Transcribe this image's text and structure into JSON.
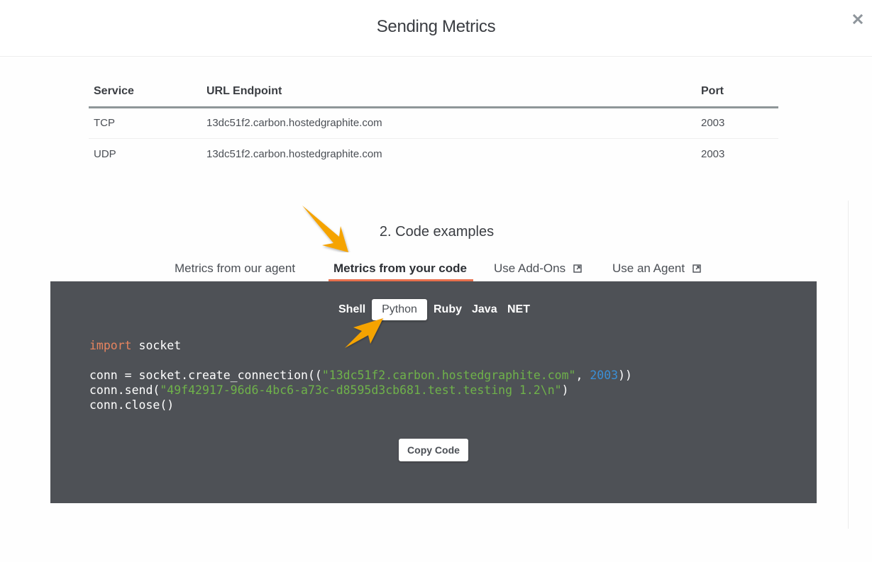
{
  "modal": {
    "title": "Sending Metrics",
    "close_icon": "close-icon"
  },
  "endpoints": {
    "headers": [
      "Service",
      "URL Endpoint",
      "Port"
    ],
    "rows": [
      {
        "service": "TCP",
        "url": "13dc51f2.carbon.hostedgraphite.com",
        "port": "2003"
      },
      {
        "service": "UDP",
        "url": "13dc51f2.carbon.hostedgraphite.com",
        "port": "2003"
      }
    ]
  },
  "code_examples": {
    "title": "2. Code examples",
    "tabs": [
      {
        "label": "Metrics from our agent",
        "active": false,
        "external": false
      },
      {
        "label": "Metrics from your code",
        "active": true,
        "external": false
      },
      {
        "label": "Use Add-Ons",
        "active": false,
        "external": true
      },
      {
        "label": "Use an Agent",
        "active": false,
        "external": true
      }
    ],
    "languages": [
      {
        "label": "Shell",
        "active": false
      },
      {
        "label": "Python",
        "active": true
      },
      {
        "label": "Ruby",
        "active": false
      },
      {
        "label": "Java",
        "active": false
      },
      {
        "label": "NET",
        "active": false
      }
    ],
    "code": {
      "line1_keyword": "import",
      "line1_rest": " socket",
      "line3_prefix": "conn = socket.create_connection((",
      "line3_string": "\"13dc51f2.carbon.hostedgraphite.com\"",
      "line3_sep": ", ",
      "line3_number": "2003",
      "line3_suffix": "))",
      "line4_prefix": "conn.send(",
      "line4_string": "\"49f42917-96d6-4bc6-a73c-d8595d3cb681.test.testing 1.2\\n\"",
      "line4_suffix": ")",
      "line5": "conn.close()"
    },
    "copy_button": "Copy Code"
  },
  "colors": {
    "accent_underline": "#e8714e",
    "code_bg": "#4e5156",
    "annotation_arrow": "#f5a300"
  }
}
